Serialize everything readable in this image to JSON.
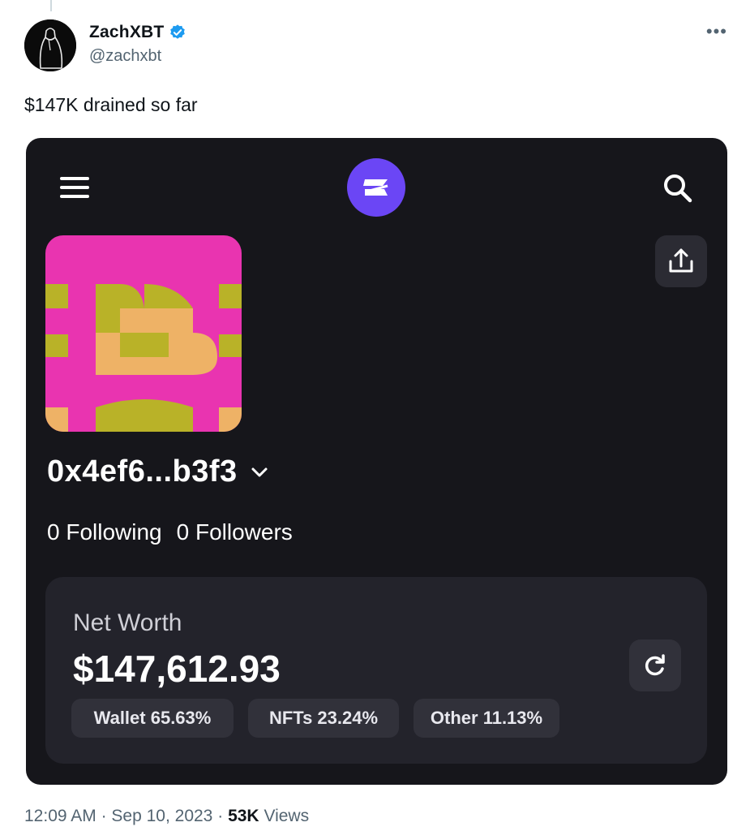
{
  "tweet": {
    "author": {
      "display_name": "ZachXBT",
      "handle": "@zachxbt",
      "verified": true
    },
    "text": "$147K drained so far",
    "meta": {
      "time": "12:09 AM",
      "separator": "·",
      "date": "Sep 10, 2023",
      "views_count": "53K",
      "views_label": "Views"
    }
  },
  "embedded_app": {
    "profile": {
      "address": "0x4ef6...b3f3",
      "following": "0 Following",
      "followers": "0 Followers"
    },
    "net_worth": {
      "label": "Net Worth",
      "value": "$147,612.93",
      "chips": [
        {
          "label": "Wallet 65.63%"
        },
        {
          "label": "NFTs 23.24%"
        },
        {
          "label": "Other 11.13%"
        }
      ]
    },
    "icons": [
      "menu-icon",
      "brand-logo-icon",
      "search-icon",
      "share-icon",
      "chevron-down-icon",
      "refresh-icon"
    ]
  },
  "colors": {
    "verified_blue": "#1d9bf0",
    "app_background": "#16161b",
    "brand_purple": "#6b46f5",
    "card_background": "#23232b",
    "nft_pink": "#e934b0",
    "nft_olive": "#b9b228",
    "nft_orange": "#eeb266"
  }
}
